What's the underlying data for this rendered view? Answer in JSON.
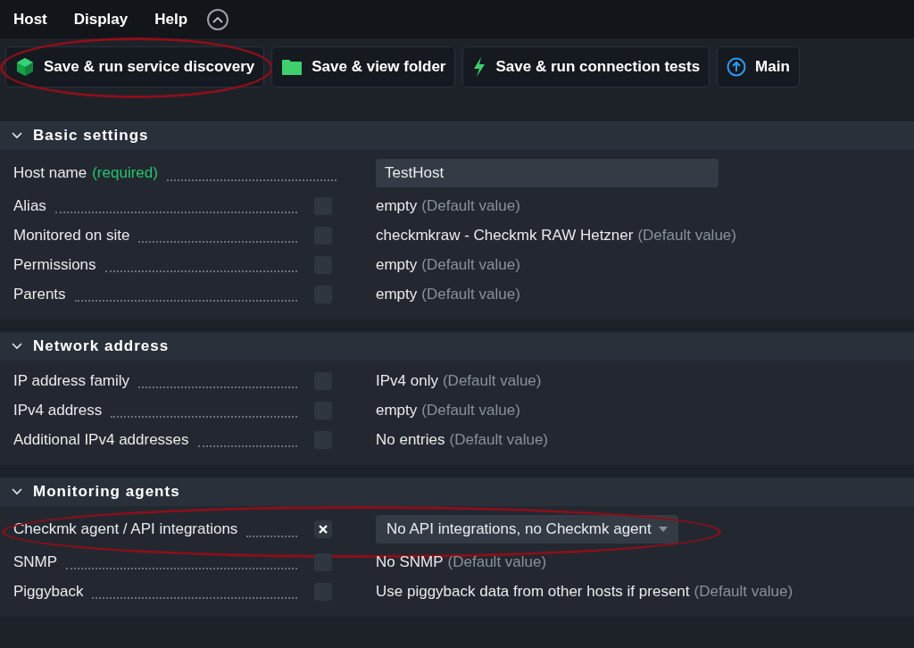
{
  "menu": [
    {
      "label": "Host"
    },
    {
      "label": "Display"
    },
    {
      "label": "Help"
    }
  ],
  "actions": [
    {
      "label": "Save & run service discovery",
      "highlighted": true
    },
    {
      "label": "Save & view folder",
      "highlighted": false
    },
    {
      "label": "Save & run connection tests",
      "highlighted": false
    },
    {
      "label": "Main",
      "highlighted": false
    }
  ],
  "sections": [
    {
      "title": "Basic settings",
      "expanded": true,
      "rows": [
        {
          "kind": "input",
          "label": "Host name",
          "required": "(required)",
          "value": "TestHost",
          "highlighted": false
        },
        {
          "kind": "default",
          "label": "Alias",
          "checked": false,
          "value": "empty",
          "note": "(Default value)",
          "highlighted": false
        },
        {
          "kind": "default",
          "label": "Monitored on site",
          "checked": false,
          "value": "checkmkraw - Checkmk RAW Hetzner",
          "note": "(Default value)",
          "highlighted": false
        },
        {
          "kind": "default",
          "label": "Permissions",
          "checked": false,
          "value": "empty",
          "note": "(Default value)",
          "highlighted": false
        },
        {
          "kind": "default",
          "label": "Parents",
          "checked": false,
          "value": "empty",
          "note": "(Default value)",
          "highlighted": false
        }
      ]
    },
    {
      "title": "Network address",
      "expanded": true,
      "rows": [
        {
          "kind": "default",
          "label": "IP address family",
          "checked": false,
          "value": "IPv4 only",
          "note": "(Default value)",
          "highlighted": false
        },
        {
          "kind": "default",
          "label": "IPv4 address",
          "checked": false,
          "value": "empty",
          "note": "(Default value)",
          "highlighted": false
        },
        {
          "kind": "default",
          "label": "Additional IPv4 addresses",
          "checked": false,
          "value": "No entries",
          "note": "(Default value)",
          "highlighted": false
        }
      ]
    },
    {
      "title": "Monitoring agents",
      "expanded": true,
      "rows": [
        {
          "kind": "dropdown",
          "label": "Checkmk agent / API integrations",
          "checked": true,
          "value": "No API integrations, no Checkmk agent",
          "highlighted": true
        },
        {
          "kind": "default",
          "label": "SNMP",
          "checked": false,
          "value": "No SNMP",
          "note": "(Default value)",
          "highlighted": false
        },
        {
          "kind": "default",
          "label": "Piggyback",
          "checked": false,
          "value": "Use piggyback data from other hosts if present",
          "note": "(Default value)",
          "highlighted": false
        }
      ]
    }
  ]
}
